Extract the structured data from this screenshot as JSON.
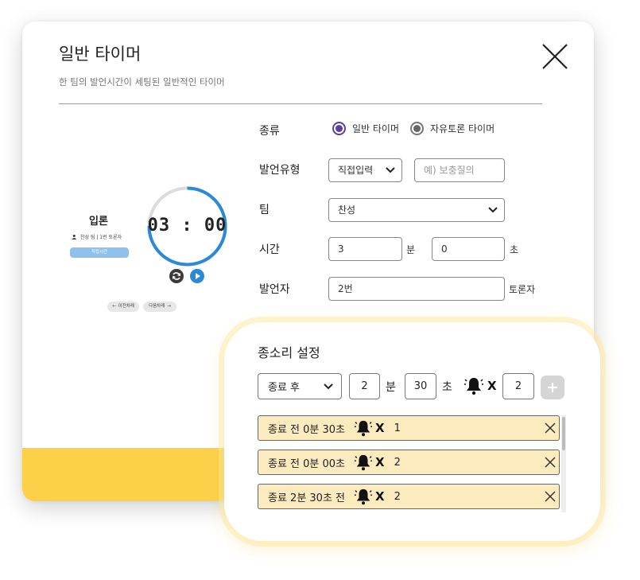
{
  "modal": {
    "title": "일반 타이머",
    "subtitle": "한 팀의 발언시간이 세팅된 일반적인 타이머",
    "footer_color": "#fdd04a"
  },
  "preview": {
    "title": "입론",
    "team_info": "찬성 팀 | 1번 토론자",
    "input_button": "직접시간",
    "time": "03 : 00",
    "prev_label": "이전차례",
    "next_label": "다음차례",
    "progress_color": "#2b8ad8",
    "progress_fraction": 0.75
  },
  "form": {
    "type_label": "종류",
    "type_options": [
      {
        "label": "일반 타이머",
        "selected": true
      },
      {
        "label": "자유토론 타이머",
        "selected": false
      }
    ],
    "speech_type_label": "발언유형",
    "speech_type_value": "직접입력",
    "speech_type_placeholder": "예) 보충질의",
    "team_label": "팀",
    "team_value": "찬성",
    "time_label": "시간",
    "minutes_value": "3",
    "minutes_unit": "분",
    "seconds_value": "0",
    "seconds_unit": "초",
    "speaker_label": "발언자",
    "speaker_value": "2번",
    "speaker_unit": "토론자",
    "radio_accent": "#5c3fa0"
  },
  "bell": {
    "title": "종소리 설정",
    "timing_value": "종료 후",
    "minutes_value": "2",
    "minutes_unit": "분",
    "seconds_value": "30",
    "seconds_unit": "초",
    "x_label": "X",
    "count_value": "2",
    "items": [
      {
        "text": "종료 전 0분 30초",
        "x": "X",
        "count": "1"
      },
      {
        "text": "종료 전 0분 00초",
        "x": "X",
        "count": "2"
      },
      {
        "text": "종료 2분 30초 전",
        "x": "X",
        "count": "2"
      }
    ],
    "item_bg": "#fdebc0"
  }
}
